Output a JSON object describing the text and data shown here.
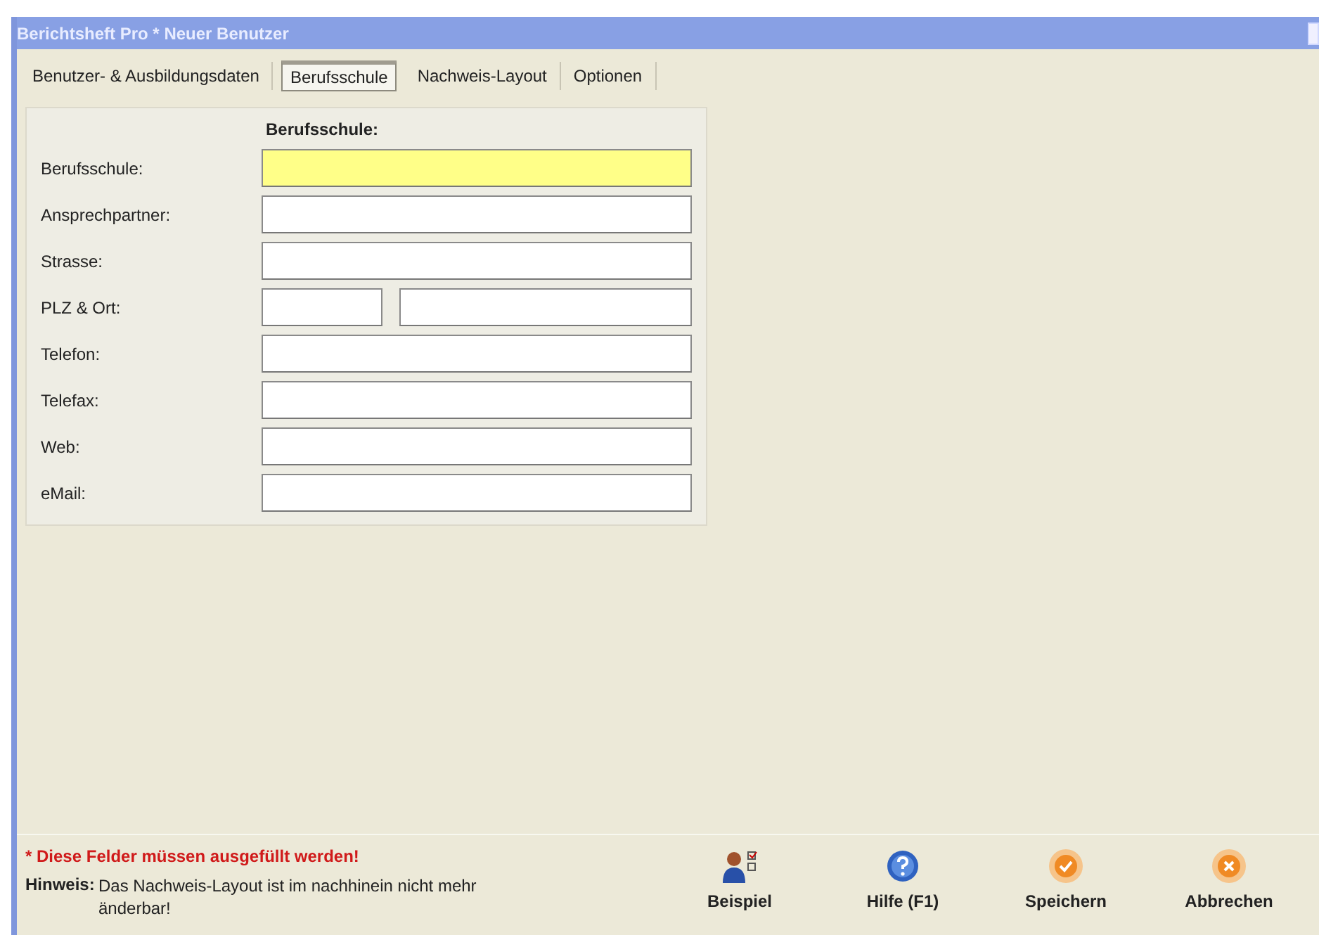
{
  "window": {
    "title": "Berichtsheft Pro * Neuer Benutzer"
  },
  "tabs": [
    {
      "label": "Benutzer- & Ausbildungsdaten",
      "selected": false
    },
    {
      "label": "Berufsschule",
      "selected": true
    },
    {
      "label": "Nachweis-Layout",
      "selected": false
    },
    {
      "label": "Optionen",
      "selected": false
    }
  ],
  "form": {
    "heading": "Berufsschule:",
    "rows": [
      {
        "label": "Berufsschule:",
        "fields": [
          {
            "required": true
          }
        ]
      },
      {
        "label": "Ansprechpartner:",
        "fields": [
          {
            "required": false
          }
        ]
      },
      {
        "label": "Strasse:",
        "fields": [
          {
            "required": false
          }
        ]
      },
      {
        "label": "PLZ & Ort:",
        "fields": [
          {
            "required": false,
            "kind": "short"
          },
          {
            "required": false,
            "kind": "long"
          }
        ]
      },
      {
        "label": "Telefon:",
        "fields": [
          {
            "required": false
          }
        ]
      },
      {
        "label": "Telefax:",
        "fields": [
          {
            "required": false
          }
        ]
      },
      {
        "label": "Web:",
        "fields": [
          {
            "required": false
          }
        ]
      },
      {
        "label": "eMail:",
        "fields": [
          {
            "required": false
          }
        ]
      }
    ]
  },
  "footer": {
    "required_note": "* Diese Felder müssen ausgefüllt werden!",
    "hint_label": "Hinweis:",
    "hint_text": "Das Nachweis-Layout ist im nachhinein nicht mehr änderbar!"
  },
  "buttons": [
    {
      "label": "Beispiel",
      "kind": "example"
    },
    {
      "label": "Hilfe (F1)",
      "kind": "help"
    },
    {
      "label": "Speichern",
      "kind": "save"
    },
    {
      "label": "Abbrechen",
      "kind": "cancel"
    }
  ]
}
